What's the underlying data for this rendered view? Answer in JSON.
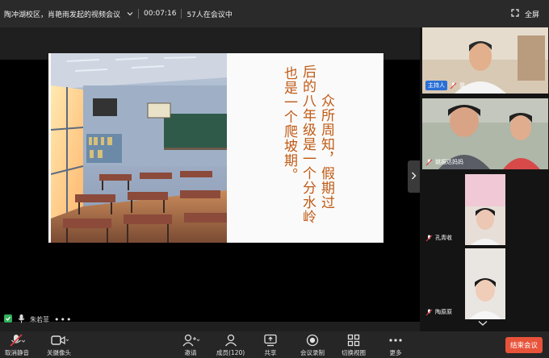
{
  "topbar": {
    "title": "陶冲湖校区，肖艳雨发起的视频会议",
    "timer": "00:07:16",
    "participants_in_meeting": "57人在会议中",
    "fullscreen_label": "全屏"
  },
  "slide": {
    "lines": [
      "众所周知，假期过",
      "后的八年级是一个分水岭",
      "也是一个爬坡期。"
    ]
  },
  "speaker": {
    "name": "朱若菲"
  },
  "participants": [
    {
      "badge": "主持人",
      "name": "我"
    },
    {
      "name": "姚振达妈妈"
    },
    {
      "name": "孔青收"
    },
    {
      "name": "陶原原"
    }
  ],
  "toolbar": {
    "mute_label": "取消静音",
    "camera_label": "关摄像头",
    "invite_label": "邀请",
    "members_label": "成员(120)",
    "share_label": "共享",
    "record_label": "会议录制",
    "view_label": "切换视图",
    "more_label": "更多",
    "end_label": "结束会议"
  },
  "colors": {
    "accent_blue": "#2a6fd6",
    "end_red": "#e8533a",
    "slide_text": "#c05a14",
    "mic_red": "#e03a3a"
  },
  "icons": [
    "chevron-down-icon",
    "fullscreen-icon",
    "mic-muted-icon",
    "camera-icon",
    "invite-icon",
    "members-icon",
    "share-icon",
    "record-icon",
    "view-grid-icon",
    "more-icon",
    "chevron-right-icon",
    "chevron-down-icon",
    "shield-icon"
  ]
}
